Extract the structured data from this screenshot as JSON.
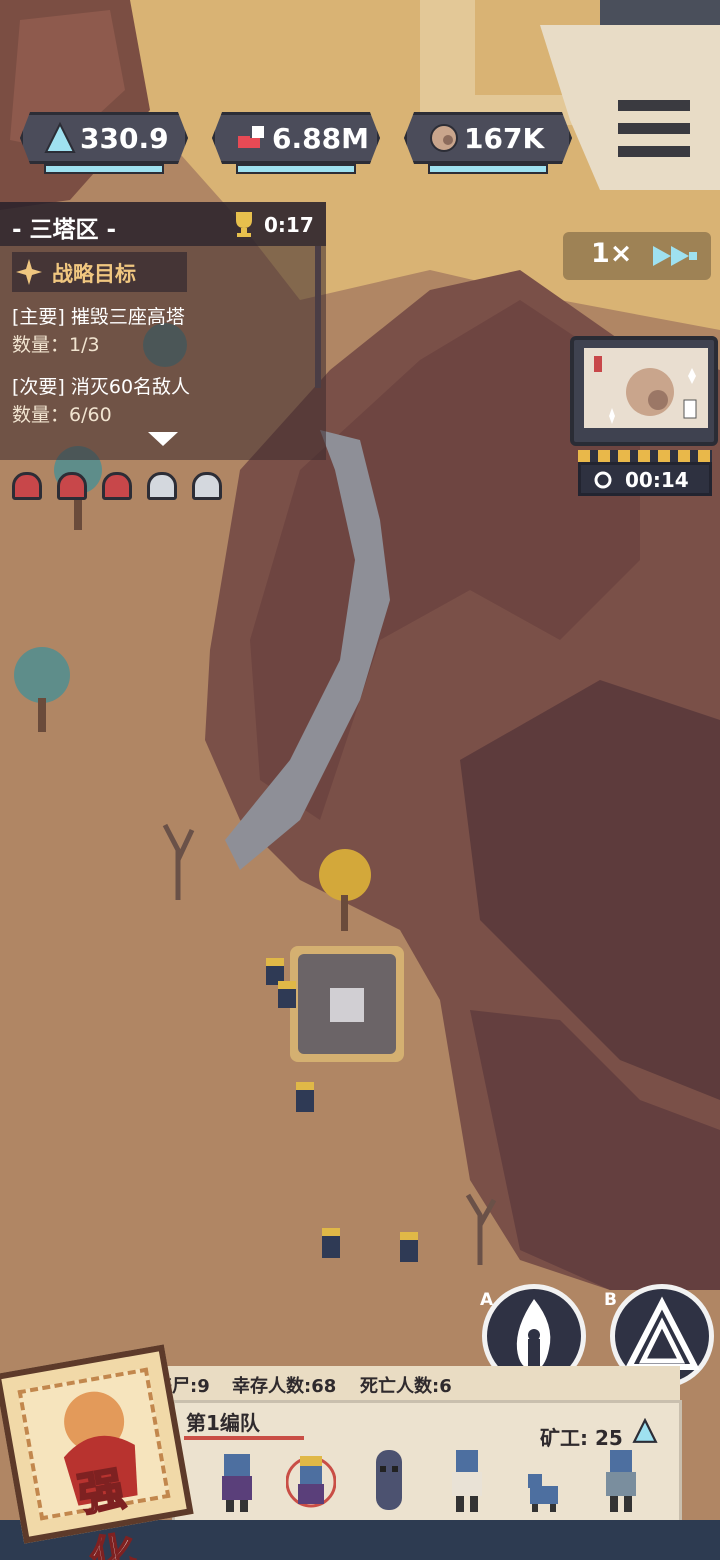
{
  "resources": [
    {
      "name": "crystal",
      "value": "330.9",
      "icon": "crystal-icon",
      "color": "#9fe1f0"
    },
    {
      "name": "gems",
      "value": "6.88M",
      "icon": "gem-icon",
      "color": "#e84a55"
    },
    {
      "name": "ore",
      "value": "167K",
      "icon": "ore-icon",
      "color": "#c9a58c"
    }
  ],
  "objective": {
    "region": "- 三塔区 -",
    "timer": "0:17",
    "header": "战略目标",
    "primary": "[主要] 摧毁三座高塔",
    "primary_count": "数量：1/3",
    "secondary": "[次要] 消灭60名敌人",
    "secondary_count": "数量：6/60"
  },
  "speed": {
    "label": "1×"
  },
  "event_timer": "00:14",
  "skills": [
    {
      "tag": "A",
      "icon": "fire-spirit-icon"
    },
    {
      "tag": "B",
      "icon": "tower-icon"
    }
  ],
  "stats": {
    "zombies": "丧尸:9",
    "survivors": "幸存人数:68",
    "dead": "死亡人数:6"
  },
  "squad": {
    "tab": "第1编队",
    "miner": "矿工: 25"
  },
  "power_button": "强化"
}
